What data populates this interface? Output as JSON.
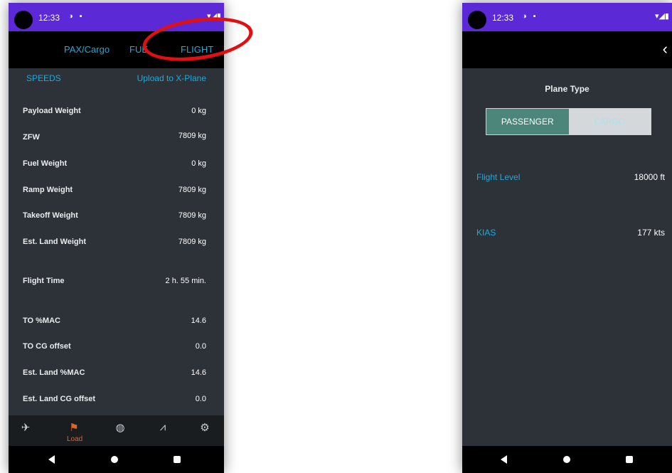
{
  "left_screen": {
    "status": {
      "time": "12:33",
      "icons_left": "◑ ▪",
      "icons_right": "▾◢▮"
    },
    "tabs": [
      "PAX/Cargo",
      "FUE",
      "FLIGHT"
    ],
    "links": {
      "speeds": "SPEEDS",
      "upload": "Upload to X-Plane"
    },
    "rows": [
      {
        "label": "Payload Weight",
        "value": "0 kg"
      },
      {
        "label": "ZFW",
        "value": "7809 kg"
      },
      {
        "label": "Fuel Weight",
        "value": "0 kg"
      },
      {
        "label": "Ramp Weight",
        "value": "7809 kg"
      },
      {
        "label": "Takeoff Weight",
        "value": "7809 kg"
      },
      {
        "label": "Est. Land Weight",
        "value": "7809 kg"
      },
      {
        "label": "Flight Time",
        "value": "2 h. 55 min."
      },
      {
        "label": "TO %MAC",
        "value": "14.6"
      },
      {
        "label": "TO CG offset",
        "value": "0.0"
      },
      {
        "label": "Est. Land %MAC",
        "value": "14.6"
      },
      {
        "label": "Est. Land CG offset",
        "value": "0.0"
      }
    ],
    "bottom_nav": {
      "items": [
        {
          "icon": "airport-icon",
          "glyph": "✈"
        },
        {
          "icon": "load-icon",
          "glyph": "⚑",
          "label": "Load",
          "active": true
        },
        {
          "icon": "globe-icon",
          "glyph": "◍"
        },
        {
          "icon": "chart-icon",
          "glyph": "⩘"
        },
        {
          "icon": "settings-icon",
          "glyph": "⚙"
        }
      ]
    }
  },
  "right_screen": {
    "status": {
      "time": "12:33",
      "icons_left": "◑ ▪",
      "icons_right": "▾◢▮"
    },
    "back_glyph": "‹",
    "plane_type_title": "Plane Type",
    "plane_type_options": [
      {
        "label": "PASSENGER",
        "selected": true
      },
      {
        "label": "CARGO",
        "selected": false
      }
    ],
    "fields": [
      {
        "label": "Flight Level",
        "value": "18000 ft"
      },
      {
        "label": "KIAS",
        "value": "177 kts"
      }
    ]
  },
  "colors": {
    "status_bar": "#5b2ad6",
    "accent_blue": "#21a9d9",
    "accent_orange": "#e0632c",
    "screen_bg": "#2c3238",
    "selected_segment": "#4c8579",
    "annotation_red": "#e01010"
  }
}
